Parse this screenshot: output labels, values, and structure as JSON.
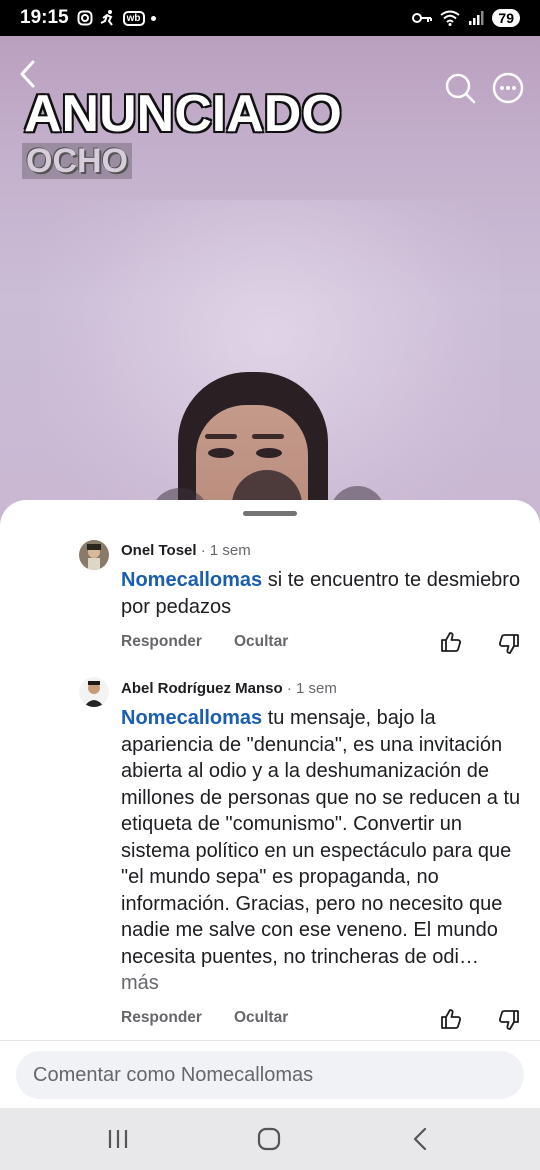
{
  "status_bar": {
    "time": "19:15",
    "app_badge": "wb",
    "battery": "79"
  },
  "video": {
    "title_overlay": "ANUNCIADO",
    "subtitle_overlay": "OCHO"
  },
  "comments": [
    {
      "author": "Onel Tosel",
      "meta": " · 1 sem",
      "mention": "Nomecallomas",
      "text": " si te encuentro te desmiebro por pedazos",
      "reply_label": "Responder",
      "hide_label": "Ocultar"
    },
    {
      "author": "Abel Rodríguez Manso",
      "meta": " · 1 sem",
      "mention": "Nomecallomas",
      "text": " tu mensaje, bajo la apariencia de \"denuncia\", es una invitación abierta al odio y a la deshumanización de millones de personas que no se reducen a tu etiqueta de \"comunismo\". Convertir un sistema político en un espectáculo para que \"el mundo sepa\" es propaganda, no información. Gracias, pero no necesito que nadie me salve con ese veneno. El mundo necesita puentes, no trincheras de odi…",
      "more_label": "más",
      "reply_label": "Responder",
      "hide_label": "Ocultar"
    }
  ],
  "comment_input": {
    "placeholder": "Comentar como Nomecallomas"
  },
  "colors": {
    "mention": "#1a5eb0",
    "secondary_text": "#65676b",
    "input_bg": "#f0f2f5"
  },
  "icons": [
    "back-icon",
    "search-icon",
    "more-options-icon",
    "like-icon",
    "dislike-icon",
    "recent-apps-icon",
    "home-icon",
    "nav-back-icon"
  ]
}
